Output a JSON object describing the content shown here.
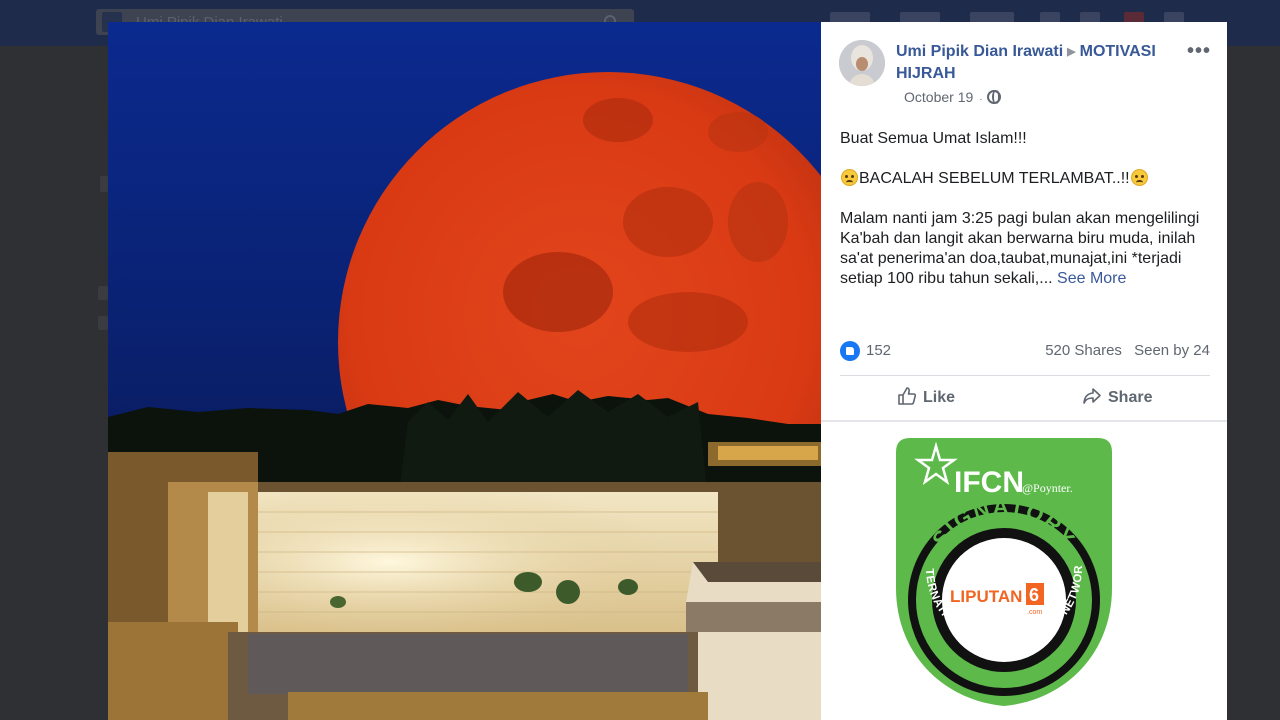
{
  "topbar": {
    "search_value": "Umi Pipik Dian Irawati"
  },
  "post": {
    "author": "Umi Pipik Dian Irawati",
    "group": "MOTIVASI HIJRAH",
    "date": "October 19",
    "paragraph1": "Buat Semua Umat Islam!!!",
    "paragraph2": "BACALAH SEBELUM TERLAMBAT..!!",
    "paragraph3": "Malam nanti jam 3:25 pagi bulan akan mengelilingi Ka'bah dan langit akan berwarna biru muda, inilah sa'at penerima'an doa,taubat,munajat,ini *terjadi setiap 100 ribu tahun sekali,... ",
    "see_more": "See More",
    "reaction_count": "152",
    "shares": "520 Shares",
    "seen_by": "Seen by 24",
    "like_label": "Like",
    "share_label": "Share"
  },
  "badge": {
    "title": "IFCN",
    "sub": "@Poynter.",
    "ring_top": "SIGNATORY",
    "ring_bottom": "INTERNATIONAL FACT-CHECKING NETWORK",
    "logo_text": "LIPUTAN",
    "logo_num": "6",
    "logo_com": ".com",
    "accent": "#5cb94a"
  },
  "icons": {
    "more": "more-options-icon",
    "privacy": "globe-icon",
    "like": "thumbs-up-icon",
    "share": "share-arrow-icon"
  }
}
